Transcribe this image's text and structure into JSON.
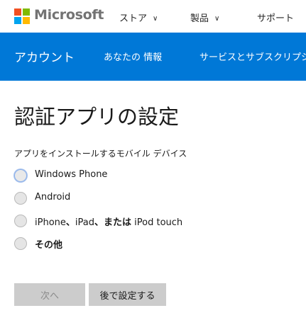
{
  "header": {
    "brand": "Microsoft",
    "nav": [
      {
        "label": "ストア"
      },
      {
        "label": "製品"
      },
      {
        "label": "サポート"
      }
    ]
  },
  "account_bar": {
    "title": "アカウント",
    "items": [
      {
        "label": "あなたの 情報"
      },
      {
        "label": "サービスとサブスクリプシ"
      }
    ]
  },
  "main": {
    "title": "認証アプリの設定",
    "subtitle": "アプリをインストールするモバイル デバイス",
    "options": [
      {
        "label": "Windows Phone",
        "selected": false
      },
      {
        "label": "Android",
        "selected": false
      },
      {
        "label_parts": [
          "iPhone",
          "、",
          "iPad",
          "、",
          "または",
          " iPod touch"
        ],
        "selected": false
      },
      {
        "label": "その他",
        "selected": false
      }
    ],
    "buttons": {
      "next": "次へ",
      "later": "後で設定する"
    }
  },
  "colors": {
    "accent": "#0078d7",
    "ms_red": "#f25022",
    "ms_green": "#7fba00",
    "ms_blue": "#00a4ef",
    "ms_yellow": "#ffb900"
  }
}
